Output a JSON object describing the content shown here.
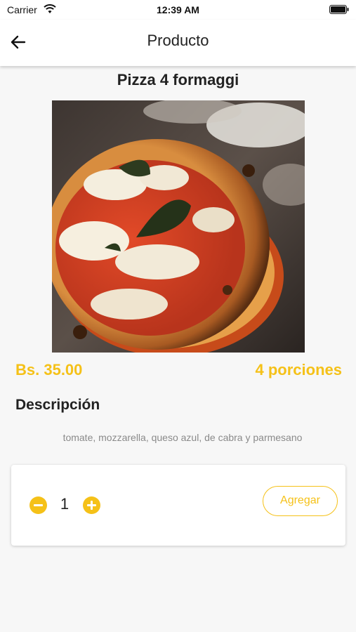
{
  "status_bar": {
    "carrier": "Carrier",
    "time": "12:39 AM",
    "wifi_icon": "wifi-icon",
    "battery_icon": "battery-icon"
  },
  "app_bar": {
    "title": "Producto",
    "back_icon": "arrow-left-icon"
  },
  "product": {
    "name": "Pizza 4 formaggi",
    "image": "pizza-photo",
    "price": "Bs. 35.00",
    "portions": "4 porciones",
    "description_heading": "Descripción",
    "description": "tomate, mozzarella, queso azul, de cabra y parmesano"
  },
  "cart": {
    "quantity": "1",
    "add_label": "Agregar",
    "minus_icon": "minus-circle-icon",
    "plus_icon": "plus-circle-icon"
  },
  "colors": {
    "accent": "#f5c118",
    "text": "#222222",
    "muted": "#8a8a8a",
    "background": "#f7f7f7"
  }
}
